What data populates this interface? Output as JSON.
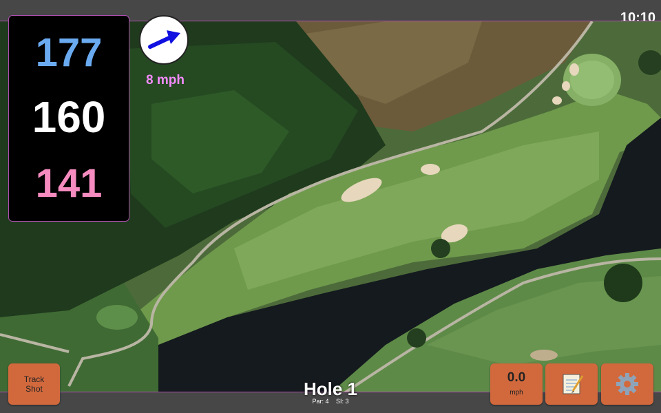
{
  "status": {
    "time": "10:10"
  },
  "distances": {
    "back": "177",
    "middle": "160",
    "front": "141",
    "back_color": "#6aaaf0",
    "middle_color": "#ffffff",
    "front_color": "#f58bbf"
  },
  "wind": {
    "speed_label": "8 mph",
    "arrow_color": "#1010e0",
    "speed_color": "#f58bff",
    "icon": "wind-direction-arrow-icon"
  },
  "hole": {
    "title": "Hole 1",
    "par": "Par: 4",
    "si": "SI: 3"
  },
  "buttons": {
    "track_shot_line1": "Track",
    "track_shot_line2": "Shot",
    "speed_value": "0.0",
    "speed_unit": "mph",
    "notes_icon": "notepad-icon",
    "settings_icon": "gear-icon",
    "accent": "#d2693d"
  }
}
